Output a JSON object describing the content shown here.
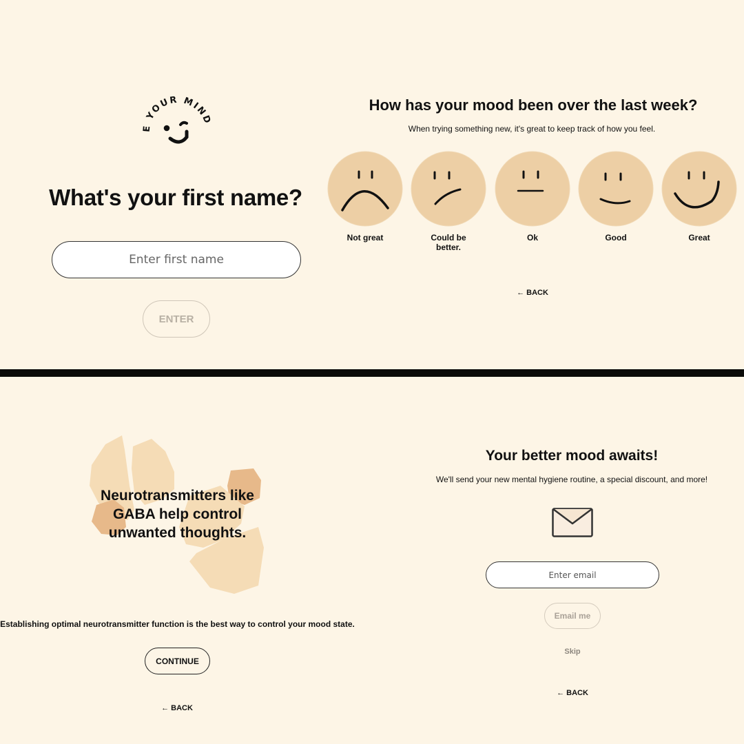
{
  "colors": {
    "background": "#fdf5e6",
    "face_fill": "#edcfa5",
    "blob_light": "#f5dcb6",
    "blob_dark": "#e7b98a",
    "divider": "#0b0b09"
  },
  "name_screen": {
    "logo_text": "PREPARE YOUR MIND",
    "logo_icon": "winking-smiley-icon",
    "title": "What's your first name?",
    "input_placeholder": "Enter first name",
    "input_value": "",
    "enter_label": "ENTER"
  },
  "mood_screen": {
    "title": "How has your mood been over the last week?",
    "subtitle": "When trying something new, it's great to keep track of how you feel.",
    "options": [
      {
        "label": "Not great",
        "icon": "frown-face-icon"
      },
      {
        "label": "Could be better.",
        "icon": "slight-frown-face-icon"
      },
      {
        "label": "Ok",
        "icon": "neutral-face-icon"
      },
      {
        "label": "Good",
        "icon": "slight-smile-face-icon"
      },
      {
        "label": "Great",
        "icon": "big-smile-face-icon"
      }
    ],
    "back_label": "← BACK"
  },
  "info_screen": {
    "title": "Neurotransmitters like GABA help control unwanted thoughts.",
    "body": "Establishing optimal neurotransmitter function is the best way to control your mood state.",
    "continue_label": "CONTINUE",
    "back_label": "← BACK"
  },
  "email_screen": {
    "title": "Your better mood awaits!",
    "subtitle": "We'll send your new mental hygiene routine, a special discount, and more!",
    "icon": "envelope-icon",
    "input_placeholder": "Enter email",
    "input_value": "",
    "submit_label": "Email me",
    "skip_label": "Skip",
    "back_label": "← BACK"
  }
}
